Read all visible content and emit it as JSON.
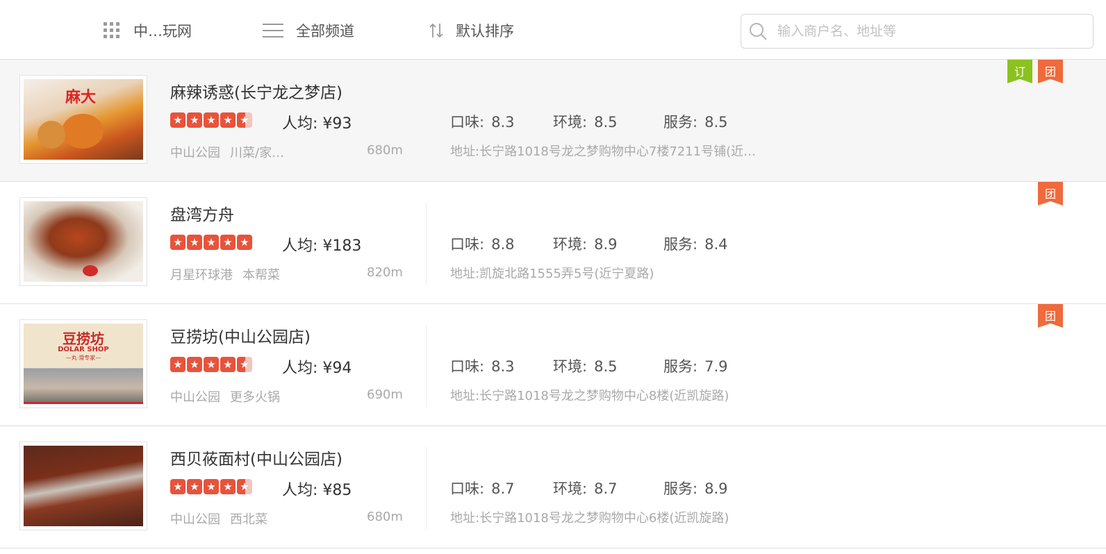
{
  "topbar": {
    "city": "中…玩网",
    "channel": "全部频道",
    "sort": "默认排序",
    "search_placeholder": "输入商户名、地址等"
  },
  "icons": {
    "city": "grid-icon",
    "channel": "menu-icon",
    "sort": "sort-arrows-icon",
    "search": "search-icon"
  },
  "colors": {
    "star": "#e8533b",
    "badge_ding": "#8cc21f",
    "badge_tuan": "#ef6a3c"
  },
  "labels": {
    "taste": "口味:",
    "env": "环境:",
    "service": "服务:"
  },
  "restaurants": [
    {
      "name": "麻辣诱惑(长宁龙之梦店)",
      "rating": 4.5,
      "avg_price": "人均: ¥93",
      "area": "中山公园",
      "category": "川菜/家…",
      "distance": "680m",
      "taste": "8.3",
      "env": "8.5",
      "service": "8.5",
      "address": "地址:长宁路1018号龙之梦购物中心7楼7211号铺(近…",
      "badges": [
        "订",
        "团"
      ],
      "thumb_text": "麻大"
    },
    {
      "name": "盘湾方舟",
      "rating": 5,
      "avg_price": "人均: ¥183",
      "area": "月星环球港",
      "category": "本帮菜",
      "distance": "820m",
      "taste": "8.8",
      "env": "8.9",
      "service": "8.4",
      "address": "地址:凯旋北路1555弄5号(近宁夏路)",
      "badges": [
        "团"
      ]
    },
    {
      "name": "豆捞坊(中山公园店)",
      "rating": 4.5,
      "avg_price": "人均: ¥94",
      "area": "中山公园",
      "category": "更多火锅",
      "distance": "690m",
      "taste": "8.3",
      "env": "8.5",
      "service": "7.9",
      "address": "地址:长宁路1018号龙之梦购物中心8楼(近凯旋路)",
      "badges": [
        "团"
      ],
      "thumb_text": "豆捞坊",
      "thumb_sub": "DOLAR SHOP",
      "thumb_sub2": "—丸·滑专家—"
    },
    {
      "name": "西贝莜面村(中山公园店)",
      "rating": 4.5,
      "avg_price": "人均: ¥85",
      "area": "中山公园",
      "category": "西北菜",
      "distance": "680m",
      "taste": "8.7",
      "env": "8.7",
      "service": "8.9",
      "address": "地址:长宁路1018号龙之梦购物中心6楼(近凯旋路)",
      "badges": []
    }
  ]
}
